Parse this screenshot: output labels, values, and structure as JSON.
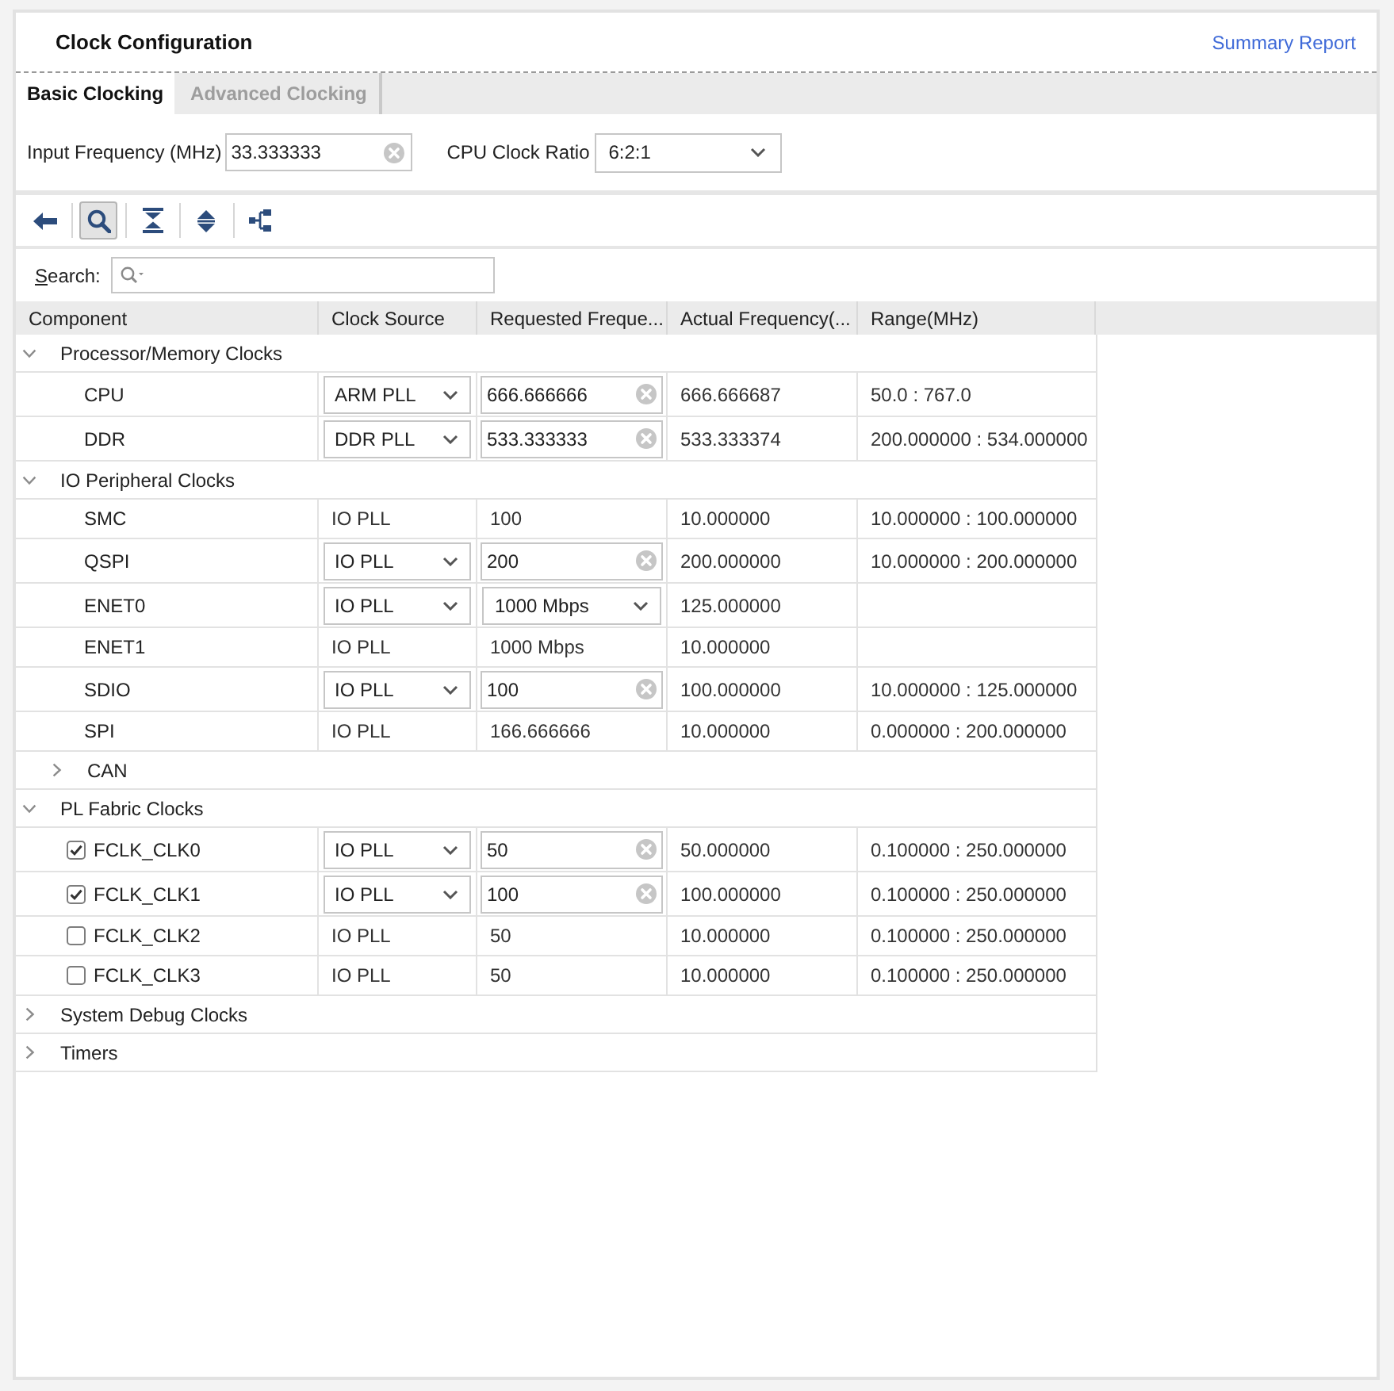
{
  "window": {
    "title": "Clock Configuration"
  },
  "summary_link": {
    "label": "Summary Report"
  },
  "tabs": [
    {
      "label": "Basic Clocking",
      "selected": true
    },
    {
      "label": "Advanced Clocking",
      "selected": false
    }
  ],
  "options": {
    "input_frequency": {
      "label": "Input Frequency (MHz)",
      "value": "33.333333"
    },
    "cpu_clock_ratio": {
      "label": "CPU Clock Ratio",
      "value": "6:2:1"
    }
  },
  "toolbar": [
    {
      "kind": "back",
      "pressed": false
    },
    {
      "kind": "search",
      "pressed": true
    },
    {
      "kind": "collapse_all",
      "pressed": false
    },
    {
      "kind": "expand_all",
      "pressed": false
    },
    {
      "kind": "hierarchy",
      "pressed": false
    }
  ],
  "search": {
    "label": "Search:"
  },
  "table": {
    "columns": [
      "Component",
      "Clock Source",
      "Requested Freque...",
      "Actual Frequency(...",
      "Range(MHz)"
    ],
    "rows": [
      {
        "kind": "group",
        "label": "Processor/Memory Clocks",
        "expanded": true,
        "children": [
          {
            "kind": "item",
            "component": "CPU",
            "clock_source": {
              "kind": "dropdown",
              "value": "ARM PLL"
            },
            "requested": {
              "kind": "field",
              "value": "666.666666"
            },
            "actual": "666.666687",
            "range": "50.0 : 767.0"
          },
          {
            "kind": "item",
            "component": "DDR",
            "clock_source": {
              "kind": "dropdown",
              "value": "DDR PLL"
            },
            "requested": {
              "kind": "field",
              "value": "533.333333"
            },
            "actual": "533.333374",
            "range": "200.000000 : 534.000000"
          }
        ]
      },
      {
        "kind": "group",
        "label": "IO Peripheral Clocks",
        "expanded": true,
        "children": [
          {
            "kind": "item",
            "component": "SMC",
            "clock_source": {
              "kind": "text",
              "value": "IO PLL"
            },
            "requested": {
              "kind": "text",
              "value": "100"
            },
            "actual": "10.000000",
            "range": "10.000000 : 100.000000"
          },
          {
            "kind": "item",
            "component": "QSPI",
            "clock_source": {
              "kind": "dropdown",
              "value": "IO PLL"
            },
            "requested": {
              "kind": "field",
              "value": "200"
            },
            "actual": "200.000000",
            "range": "10.000000 : 200.000000"
          },
          {
            "kind": "item",
            "component": "ENET0",
            "clock_source": {
              "kind": "dropdown",
              "value": "IO PLL"
            },
            "requested": {
              "kind": "dropdown",
              "value": "1000 Mbps"
            },
            "actual": "125.000000"
          },
          {
            "kind": "item",
            "component": "ENET1",
            "clock_source": {
              "kind": "text",
              "value": "IO PLL"
            },
            "requested": {
              "kind": "text",
              "value": "1000 Mbps"
            },
            "actual": "10.000000"
          },
          {
            "kind": "item",
            "component": "SDIO",
            "clock_source": {
              "kind": "dropdown",
              "value": "IO PLL"
            },
            "requested": {
              "kind": "field",
              "value": "100"
            },
            "actual": "100.000000",
            "range": "10.000000 : 125.000000"
          },
          {
            "kind": "item",
            "component": "SPI",
            "clock_source": {
              "kind": "text",
              "value": "IO PLL"
            },
            "requested": {
              "kind": "text",
              "value": "166.666666"
            },
            "actual": "10.000000",
            "range": "0.000000 : 200.000000"
          },
          {
            "kind": "group",
            "label": "CAN",
            "expanded": false
          }
        ]
      },
      {
        "kind": "group",
        "label": "PL Fabric Clocks",
        "expanded": true,
        "children": [
          {
            "kind": "item",
            "component": "FCLK_CLK0",
            "checked": true,
            "clock_source": {
              "kind": "dropdown",
              "value": "IO PLL"
            },
            "requested": {
              "kind": "field",
              "value": "50"
            },
            "actual": "50.000000",
            "range": "0.100000 : 250.000000"
          },
          {
            "kind": "item",
            "component": "FCLK_CLK1",
            "checked": true,
            "clock_source": {
              "kind": "dropdown",
              "value": "IO PLL"
            },
            "requested": {
              "kind": "field",
              "value": "100"
            },
            "actual": "100.000000",
            "range": "0.100000 : 250.000000"
          },
          {
            "kind": "item",
            "component": "FCLK_CLK2",
            "checked": false,
            "clock_source": {
              "kind": "text",
              "value": "IO PLL"
            },
            "requested": {
              "kind": "text",
              "value": "50"
            },
            "actual": "10.000000",
            "range": "0.100000 : 250.000000"
          },
          {
            "kind": "item",
            "component": "FCLK_CLK3",
            "checked": false,
            "clock_source": {
              "kind": "text",
              "value": "IO PLL"
            },
            "requested": {
              "kind": "text",
              "value": "50"
            },
            "actual": "10.000000",
            "range": "0.100000 : 250.000000"
          }
        ]
      },
      {
        "kind": "group",
        "label": "System Debug Clocks",
        "expanded": false
      },
      {
        "kind": "group",
        "label": "Timers",
        "expanded": false
      }
    ]
  }
}
